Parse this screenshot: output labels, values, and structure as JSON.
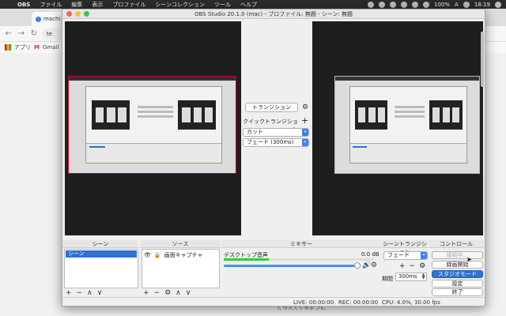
{
  "menubar": {
    "app": "OBS",
    "items": [
      "ファイル",
      "編集",
      "表示",
      "プロファイル",
      "シーンコレクション",
      "ツール",
      "ヘルプ"
    ],
    "battery": "100%",
    "time": "18:19",
    "input_label": "A"
  },
  "browser": {
    "tab_title": "machi",
    "url": "te",
    "bookmarks": [
      "アプリ",
      "Gmail"
    ],
    "footer": "とらえてくるように"
  },
  "obs": {
    "title": "OBS Studio 20.1.0 (mac) - プロファイル: 無題 - シーン: 無題",
    "transition_button": "トランジション",
    "quick_transition_label": "クイックトランジション",
    "quick_options": [
      "カット",
      "フェード (300ms)"
    ],
    "docks": {
      "scenes": "シーン",
      "sources": "ソース",
      "mixer": "ミキサー",
      "scene_transitions": "シーントランジション",
      "controls": "コントロール"
    },
    "scenes": [
      "シーン"
    ],
    "sources": [
      "画面キャプチャ"
    ],
    "mixer": {
      "track": "デスクトップ音声",
      "db": "0.0 dB",
      "level": 0.3
    },
    "scene_transition": {
      "selected": "フェード",
      "duration_label": "期間",
      "duration": "300ms"
    },
    "controls": [
      "接続中...",
      "録画開始",
      "スタジオモード",
      "設定",
      "終了"
    ],
    "status": {
      "live": "LIVE: 00:00:00",
      "rec": "REC: 00:00:00",
      "cpu": "CPU: 4.0%, 30.00 fps"
    }
  },
  "colors": {
    "accent": "#2f6fd6",
    "menubar": "#2b2b2b",
    "preview_bg": "#1e1e1e"
  }
}
